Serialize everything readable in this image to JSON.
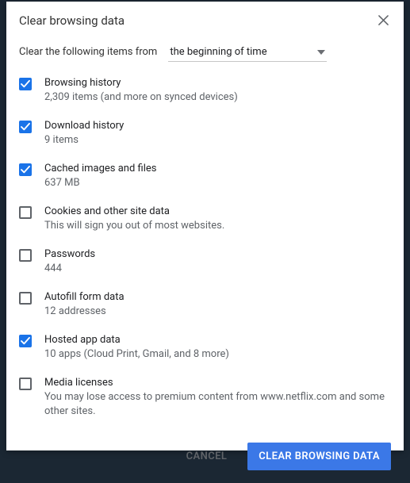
{
  "dialog": {
    "title": "Clear browsing data"
  },
  "range": {
    "label": "Clear the following items from",
    "selected": "the beginning of time"
  },
  "items": [
    {
      "label": "Browsing history",
      "sub": "2,309 items (and more on synced devices)",
      "checked": true
    },
    {
      "label": "Download history",
      "sub": "9 items",
      "checked": true
    },
    {
      "label": "Cached images and files",
      "sub": "637 MB",
      "checked": true
    },
    {
      "label": "Cookies and other site data",
      "sub": "This will sign you out of most websites.",
      "checked": false
    },
    {
      "label": "Passwords",
      "sub": "444",
      "checked": false
    },
    {
      "label": "Autofill form data",
      "sub": "12 addresses",
      "checked": false
    },
    {
      "label": "Hosted app data",
      "sub": "10 apps (Cloud Print, Gmail, and 8 more)",
      "checked": true
    },
    {
      "label": "Media licenses",
      "sub": "You may lose access to premium content from www.netflix.com and some other sites.",
      "checked": false
    }
  ],
  "footer": {
    "cancel": "CANCEL",
    "confirm": "CLEAR BROWSING DATA"
  }
}
